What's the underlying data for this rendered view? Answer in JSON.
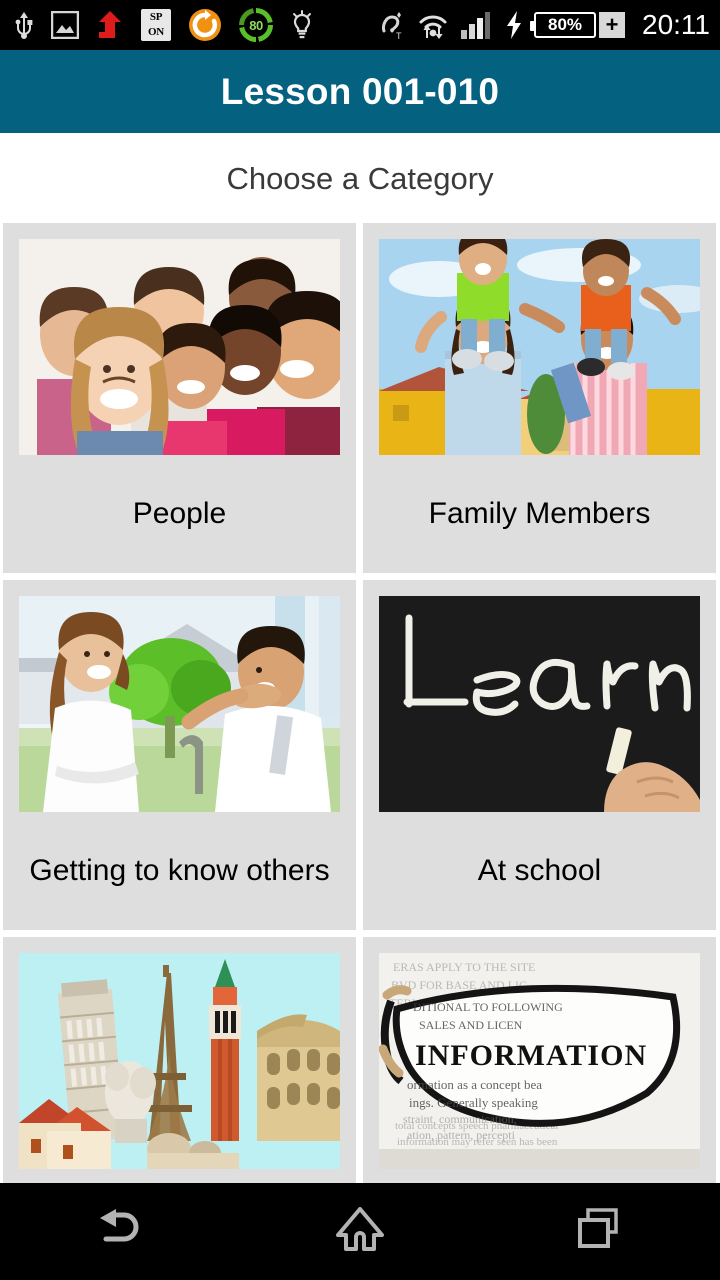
{
  "status_bar": {
    "time": "20:11",
    "battery_percent": "80%",
    "charge_ring_value": "80",
    "sp_badge_line1": "SP",
    "sp_badge_line2": "ON",
    "plus_label": "+",
    "icons": [
      "usb-icon",
      "gallery-image-icon",
      "red-upload-arrow-icon",
      "sp-on-badge-icon",
      "sync-circle-icon",
      "charge-ring-icon",
      "lightbulb-icon",
      "hearing-aid-t-icon",
      "wifi-transfer-icon",
      "signal-bars-icon",
      "charging-bolt-icon",
      "battery-icon",
      "plus-box-icon"
    ]
  },
  "app_bar": {
    "title": "Lesson 001-010",
    "background_color": "#04617f",
    "text_color": "#ffffff"
  },
  "main": {
    "page_title": "Choose a Category",
    "card_background_color": "#dedede",
    "categories": [
      {
        "label": "People",
        "image_name": "group-of-smiling-people-photo"
      },
      {
        "label": "Family Members",
        "image_name": "family-with-children-on-shoulders-photo"
      },
      {
        "label": "Getting to know others",
        "image_name": "couple-talking-outdoors-photo"
      },
      {
        "label": "At school",
        "image_name": "chalkboard-with-learn-written-photo"
      },
      {
        "label": "",
        "image_name": "european-landmarks-collage-photo"
      },
      {
        "label": "",
        "image_name": "eyeglass-lens-over-information-text-photo"
      }
    ]
  },
  "nav_bar": {
    "buttons": [
      {
        "name": "back-button",
        "icon": "back-arrow-icon"
      },
      {
        "name": "home-button",
        "icon": "home-icon"
      },
      {
        "name": "recents-button",
        "icon": "recent-apps-icon"
      }
    ],
    "icon_color": "#b0b0b0"
  }
}
